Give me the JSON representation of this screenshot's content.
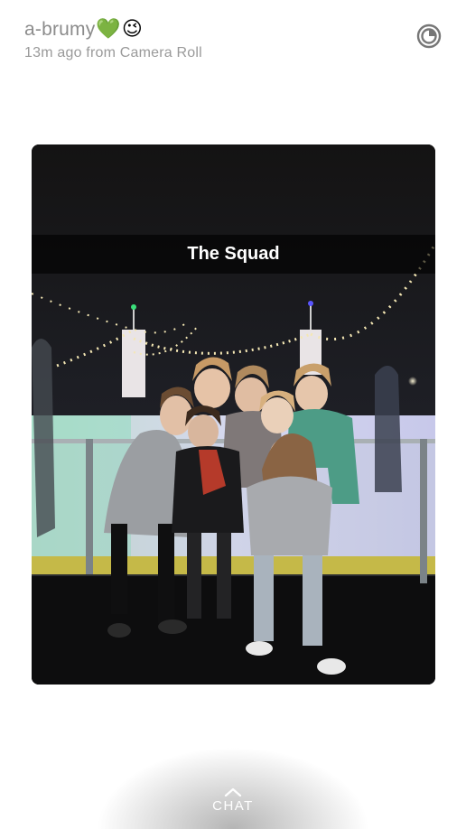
{
  "header": {
    "username": "a-brumy",
    "emojis": [
      "💚",
      "😉"
    ],
    "subtitle": "13m ago from Camera Roll"
  },
  "icons": {
    "stories": "stories-ring-icon",
    "chat_chevron": "chevron-up-icon"
  },
  "snap": {
    "caption": "The Squad",
    "image_description": "Group of girls posing at an outdoor ice rink at night under string lights"
  },
  "footer": {
    "chat_label": "CHAT"
  },
  "colors": {
    "background": "#ffffff",
    "username": "#8c8c8c",
    "subtitle": "#9a9a9a",
    "caption_bar": "rgba(0,0,0,0.62)"
  }
}
